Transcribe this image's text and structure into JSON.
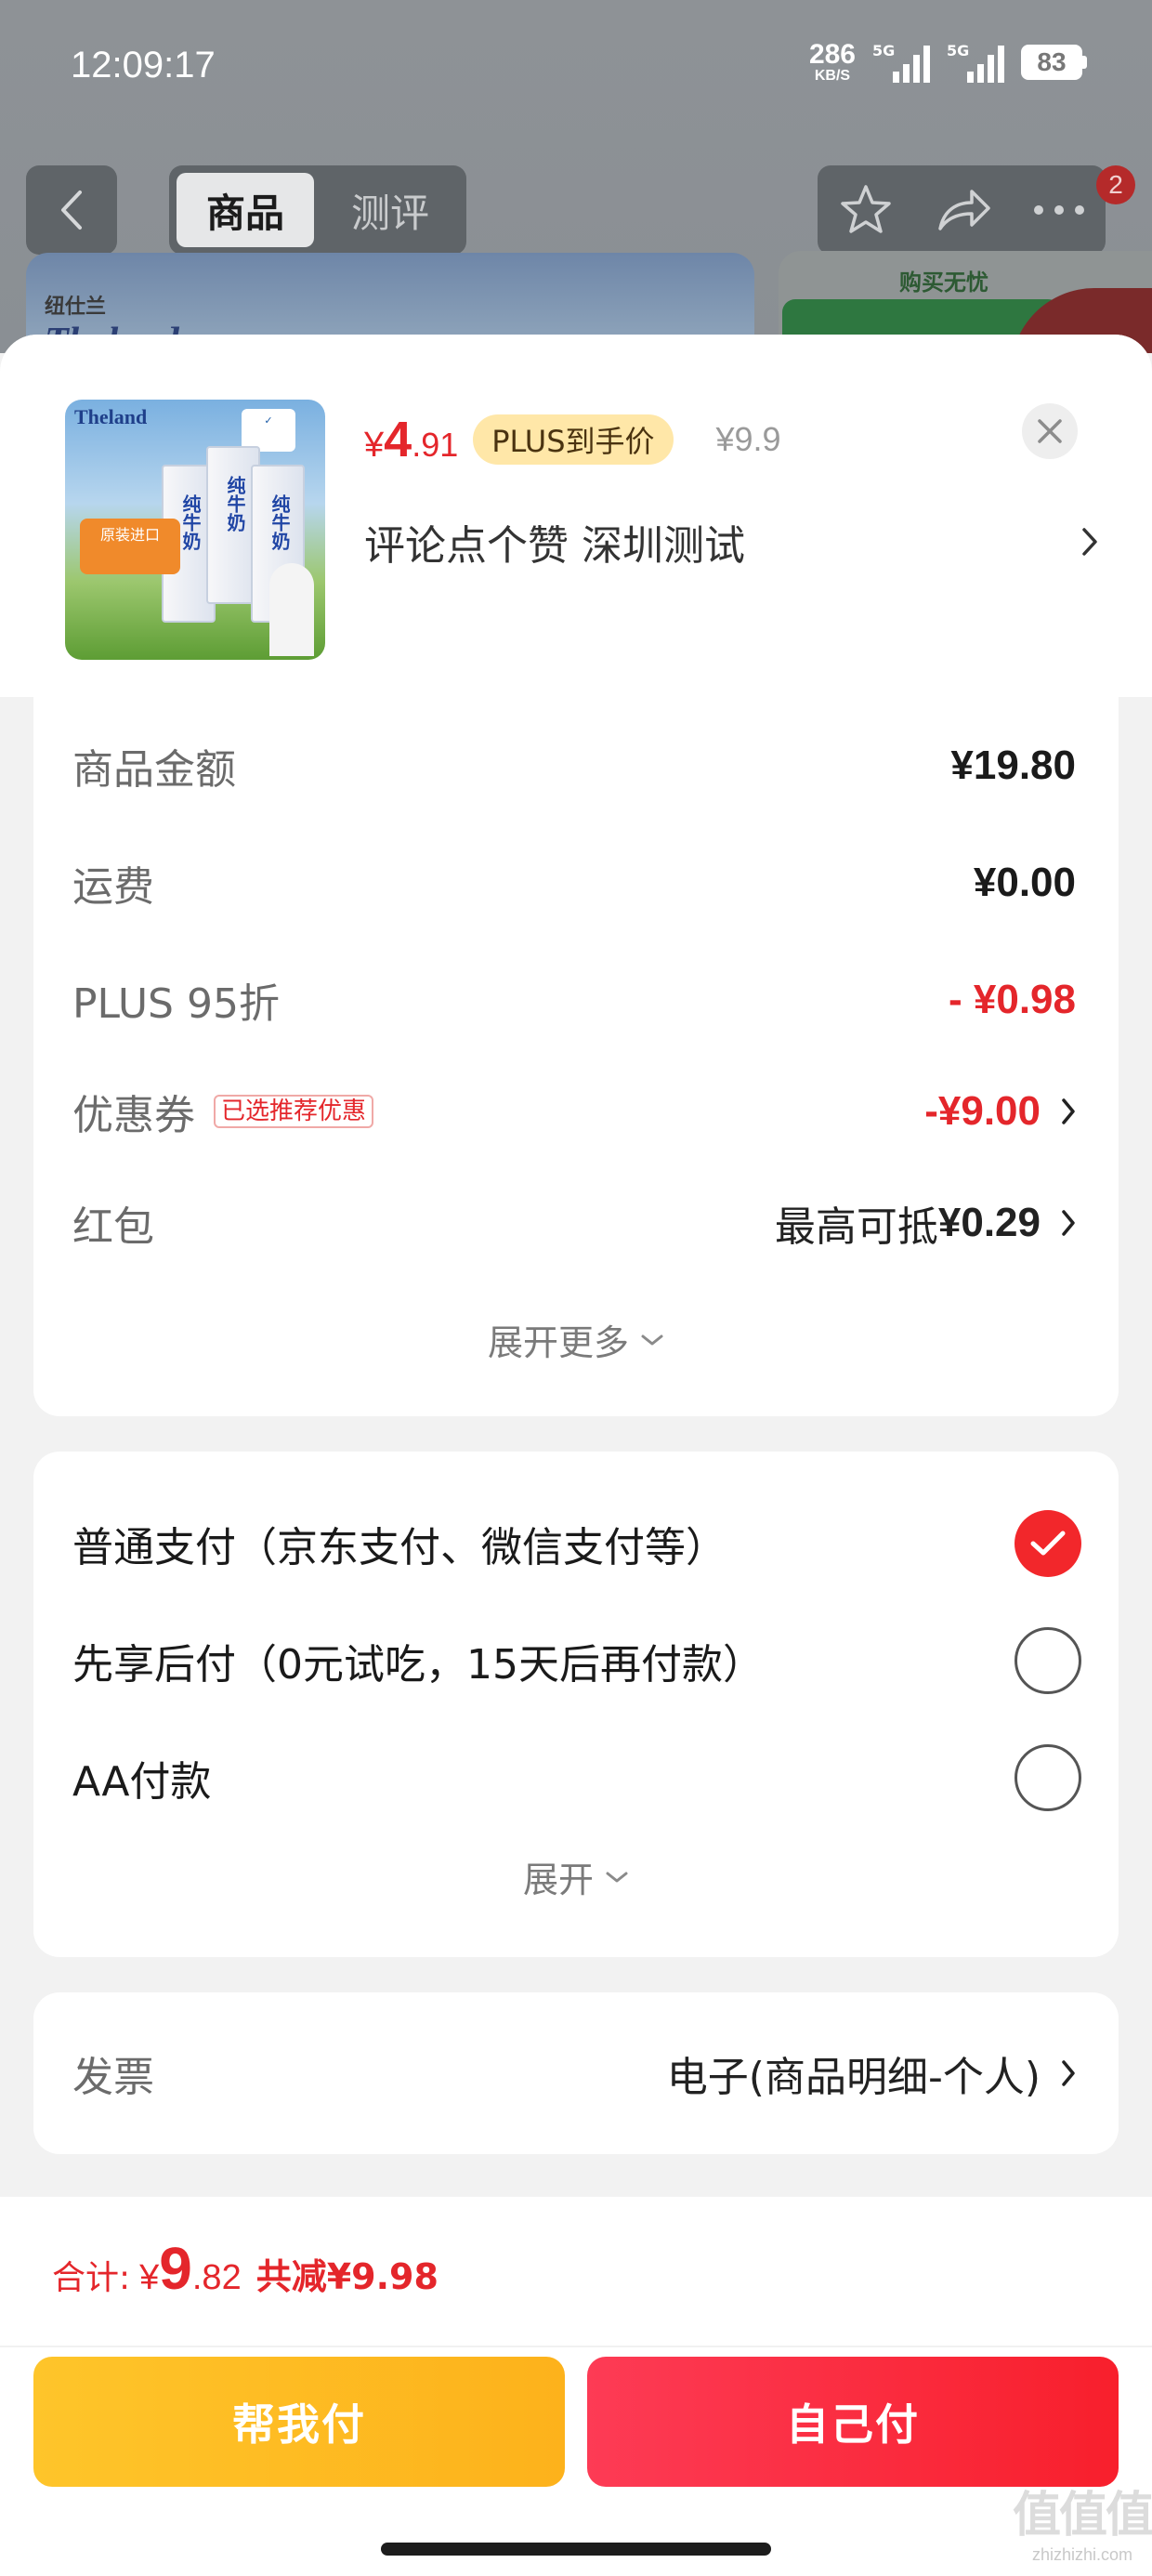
{
  "status_bar": {
    "time": "12:09:17",
    "net_speed": "286",
    "net_unit": "KB/S",
    "sim1": "5G",
    "sim2": "5G",
    "battery": "83"
  },
  "nav": {
    "tabs": [
      "商品",
      "测评"
    ],
    "active_tab": "商品",
    "cart_badge": "2"
  },
  "background": {
    "brand": "Theland",
    "brand_cn": "纽仕兰",
    "promo": "购买无忧"
  },
  "product": {
    "brand": "Theland",
    "image_tag": "原装进口",
    "carton_label": "纯牛奶",
    "price_currency": "¥",
    "price_int": "4",
    "price_dec": ".91",
    "plus_badge": "PLUS到手价",
    "original_price": "¥9.9",
    "spec": "评论点个赞  深圳测试"
  },
  "cost": {
    "goods_label": "商品金额",
    "goods_value": "¥19.80",
    "shipping_label": "运费",
    "shipping_value": "¥0.00",
    "plus_label": "PLUS 95折",
    "plus_value": "- ¥0.98",
    "coupon_label": "优惠券",
    "coupon_tag": "已选推荐优惠",
    "coupon_value": "-¥9.00",
    "redpacket_label": "红包",
    "redpacket_prefix": "最高可抵",
    "redpacket_value": "¥0.29",
    "expand_more": "展开更多"
  },
  "payment": {
    "options": [
      {
        "label": "普通支付（京东支付、微信支付等）",
        "selected": true
      },
      {
        "label": "先享后付（0元试吃，15天后再付款）",
        "selected": false
      },
      {
        "label": "AA付款",
        "selected": false
      }
    ],
    "expand": "展开"
  },
  "invoice": {
    "label": "发票",
    "value": "电子(商品明细-个人)"
  },
  "footer": {
    "total_label": "合计:",
    "total_currency": "¥",
    "total_int": "9",
    "total_dec": ".82",
    "saved": "共减¥9.98",
    "help_pay_label": "帮我付",
    "self_pay_label": "自己付",
    "watermark": "值值值",
    "watermark_site": "zhizhizhi.com"
  },
  "colors": {
    "accent_red": "#e4262b",
    "help_btn": "#fdb21b",
    "self_btn": "#f81f2c",
    "plus_badge_bg": "#ffe7a8"
  }
}
